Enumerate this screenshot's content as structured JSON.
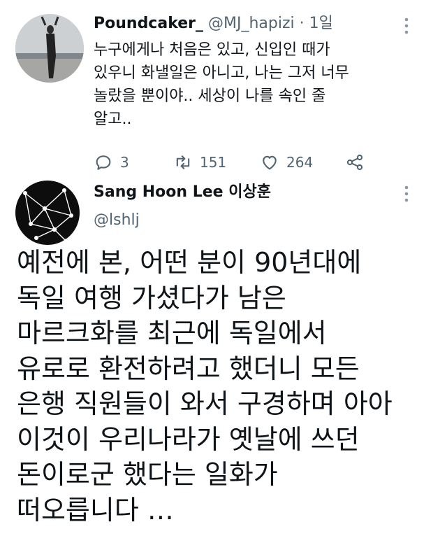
{
  "reply": {
    "display_name": "Poundcaker_",
    "handle": "@MJ_hapizi",
    "separator": " · ",
    "time": "1일",
    "text": "누구에게나 처음은 있고, 신입인 때가\n있우니 화낼일은 아니고, 나는 그저 너무\n놀랐을 뿐이야.. 세상이 나를 속인 줄\n알고..",
    "actions": {
      "replies": "3",
      "retweets": "151",
      "likes": "264"
    },
    "icons": [
      "more-icon",
      "reply-icon",
      "retweet-icon",
      "like-icon",
      "share-icon"
    ]
  },
  "main": {
    "display_name": "Sang Hoon Lee 이상훈",
    "handle": "@lshlj",
    "text": "예전에 본, 어떤 분이 90년대에\n독일 여행 가셨다가 남은\n마르크화를 최근에 독일에서\n유로로 환전하려고 했더니 모든\n은행 직원들이 와서 구경하며 아아\n이것이 우리나라가 옛날에 쓰던\n돈이로군 했다는 일화가\n떠오릅니다 …",
    "icons": [
      "more-icon"
    ]
  },
  "colors": {
    "text": "#0f1419",
    "muted": "#536471",
    "background": "#ffffff"
  }
}
